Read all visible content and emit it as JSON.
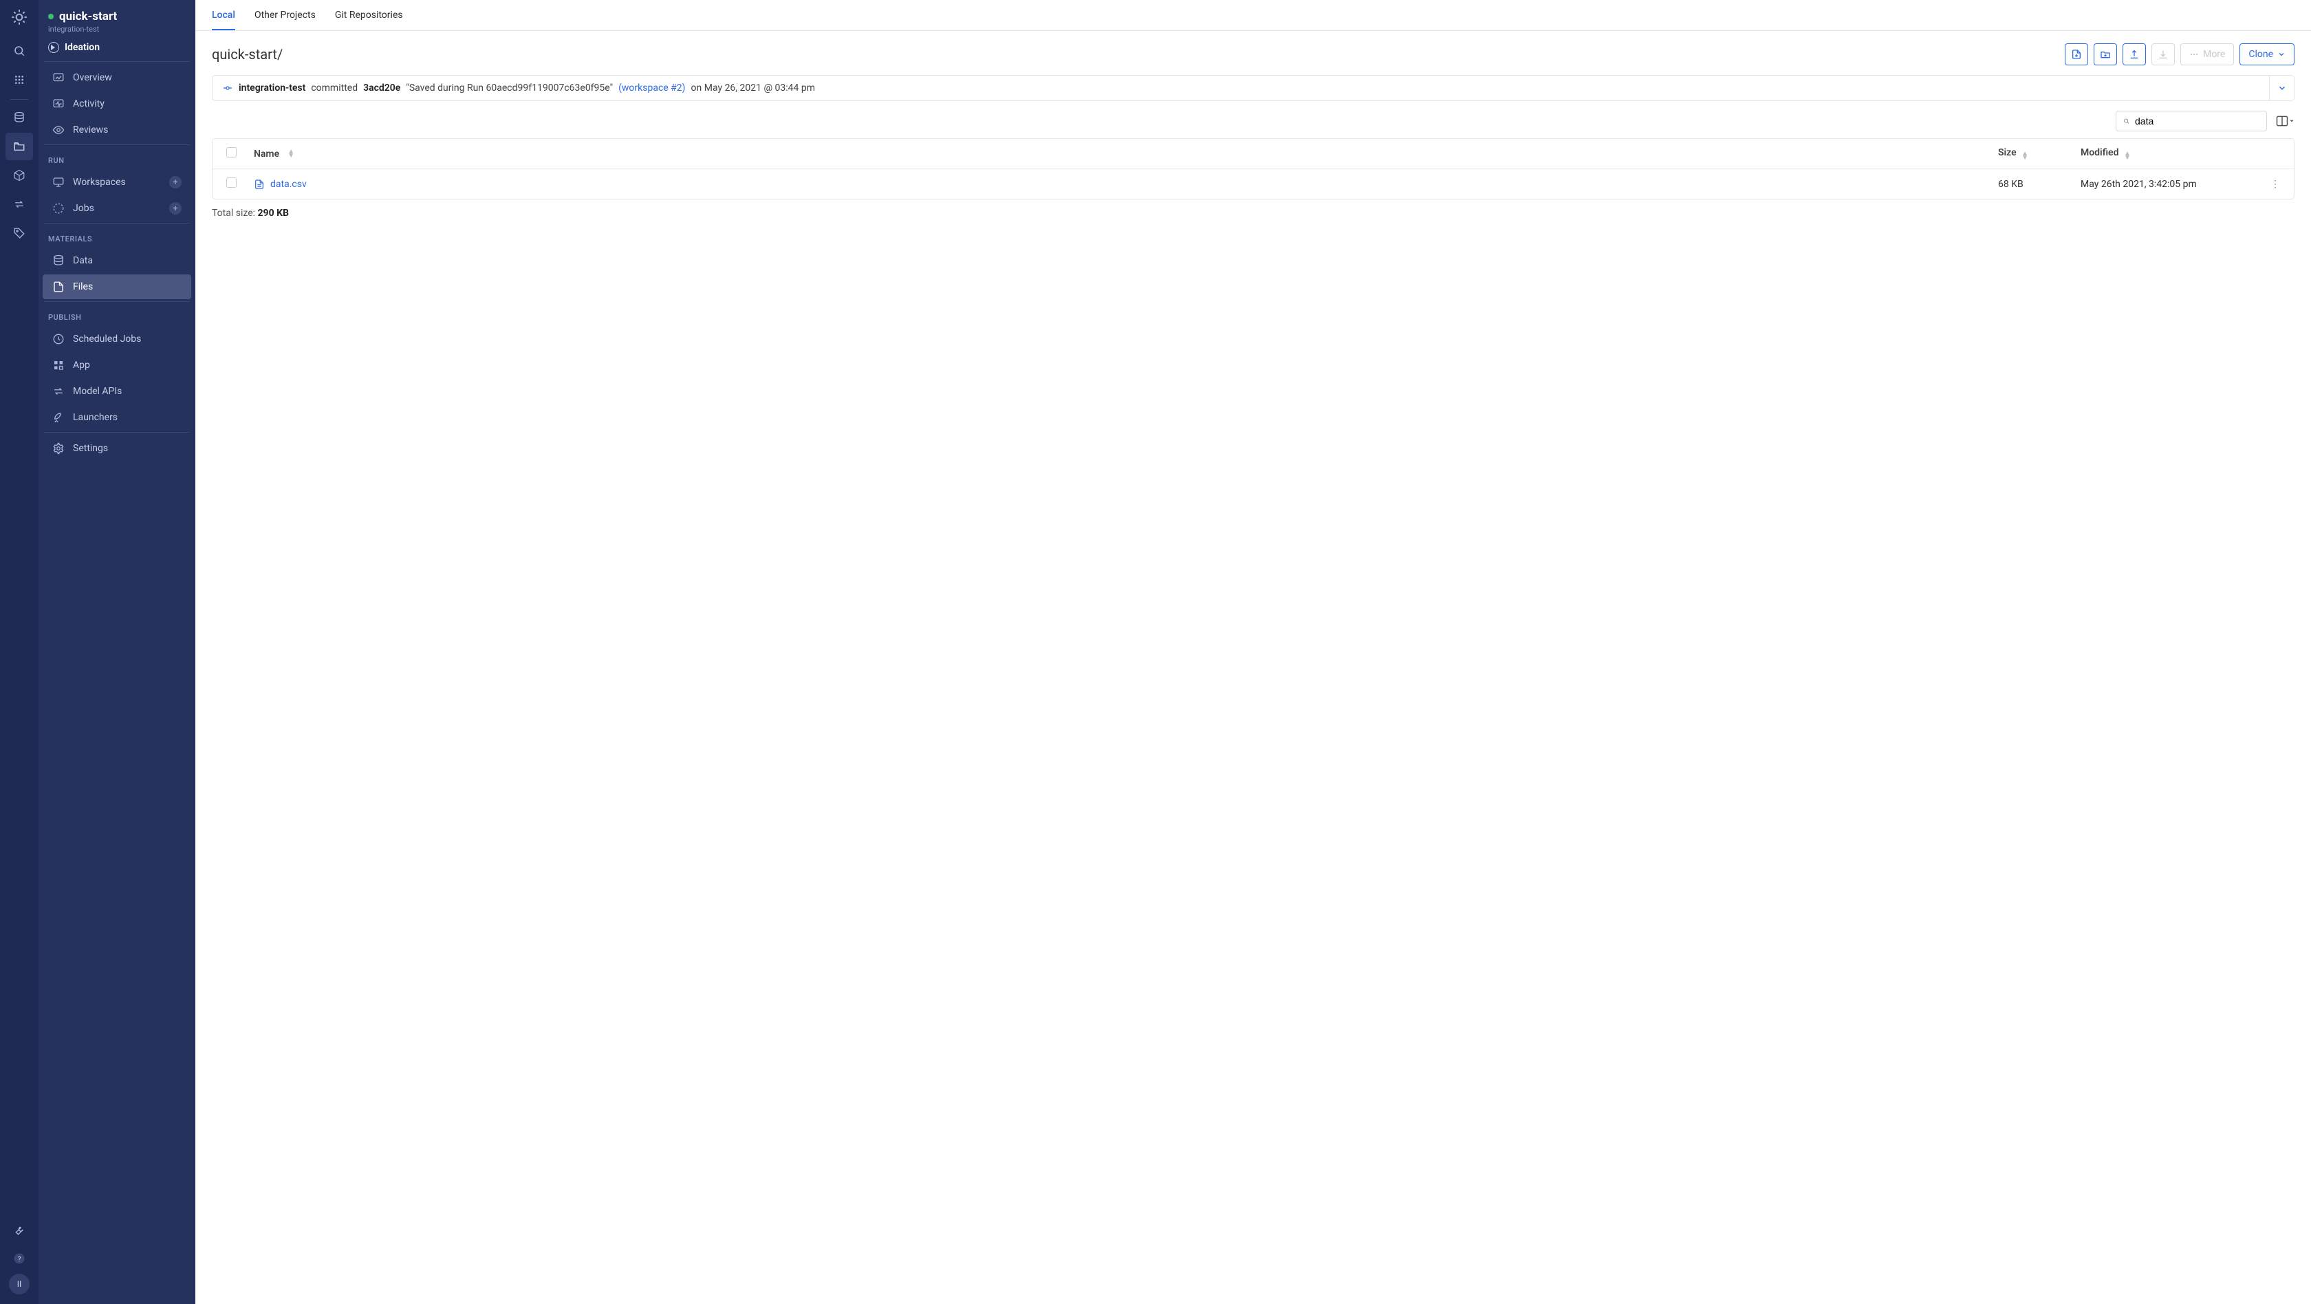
{
  "rail": {
    "avatar_initials": "II"
  },
  "sidebar": {
    "project_name": "quick-start",
    "project_owner": "integration-test",
    "phase": "Ideation",
    "items": {
      "overview": "Overview",
      "activity": "Activity",
      "reviews": "Reviews",
      "workspaces": "Workspaces",
      "jobs": "Jobs",
      "data": "Data",
      "files": "Files",
      "scheduled_jobs": "Scheduled Jobs",
      "app": "App",
      "model_apis": "Model APIs",
      "launchers": "Launchers",
      "settings": "Settings"
    },
    "sections": {
      "run": "RUN",
      "materials": "MATERIALS",
      "publish": "PUBLISH"
    }
  },
  "tabs": {
    "local": "Local",
    "other_projects": "Other Projects",
    "git": "Git Repositories"
  },
  "breadcrumb": "quick-start/",
  "actions": {
    "more": "More",
    "clone": "Clone"
  },
  "commit": {
    "author": "integration-test",
    "verb": "committed",
    "hash": "3acd20e",
    "message": "\"Saved during Run 60aecd99f119007c63e0f95e\"",
    "workspace_link": "(workspace #2)",
    "timestamp": "on May 26, 2021 @ 03:44 pm"
  },
  "search": {
    "value": "data"
  },
  "table": {
    "headers": {
      "name": "Name",
      "size": "Size",
      "modified": "Modified"
    },
    "rows": [
      {
        "name": "data.csv",
        "size": "68 KB",
        "modified": "May 26th 2021, 3:42:05 pm"
      }
    ]
  },
  "total": {
    "label": "Total size: ",
    "value": "290 KB"
  }
}
